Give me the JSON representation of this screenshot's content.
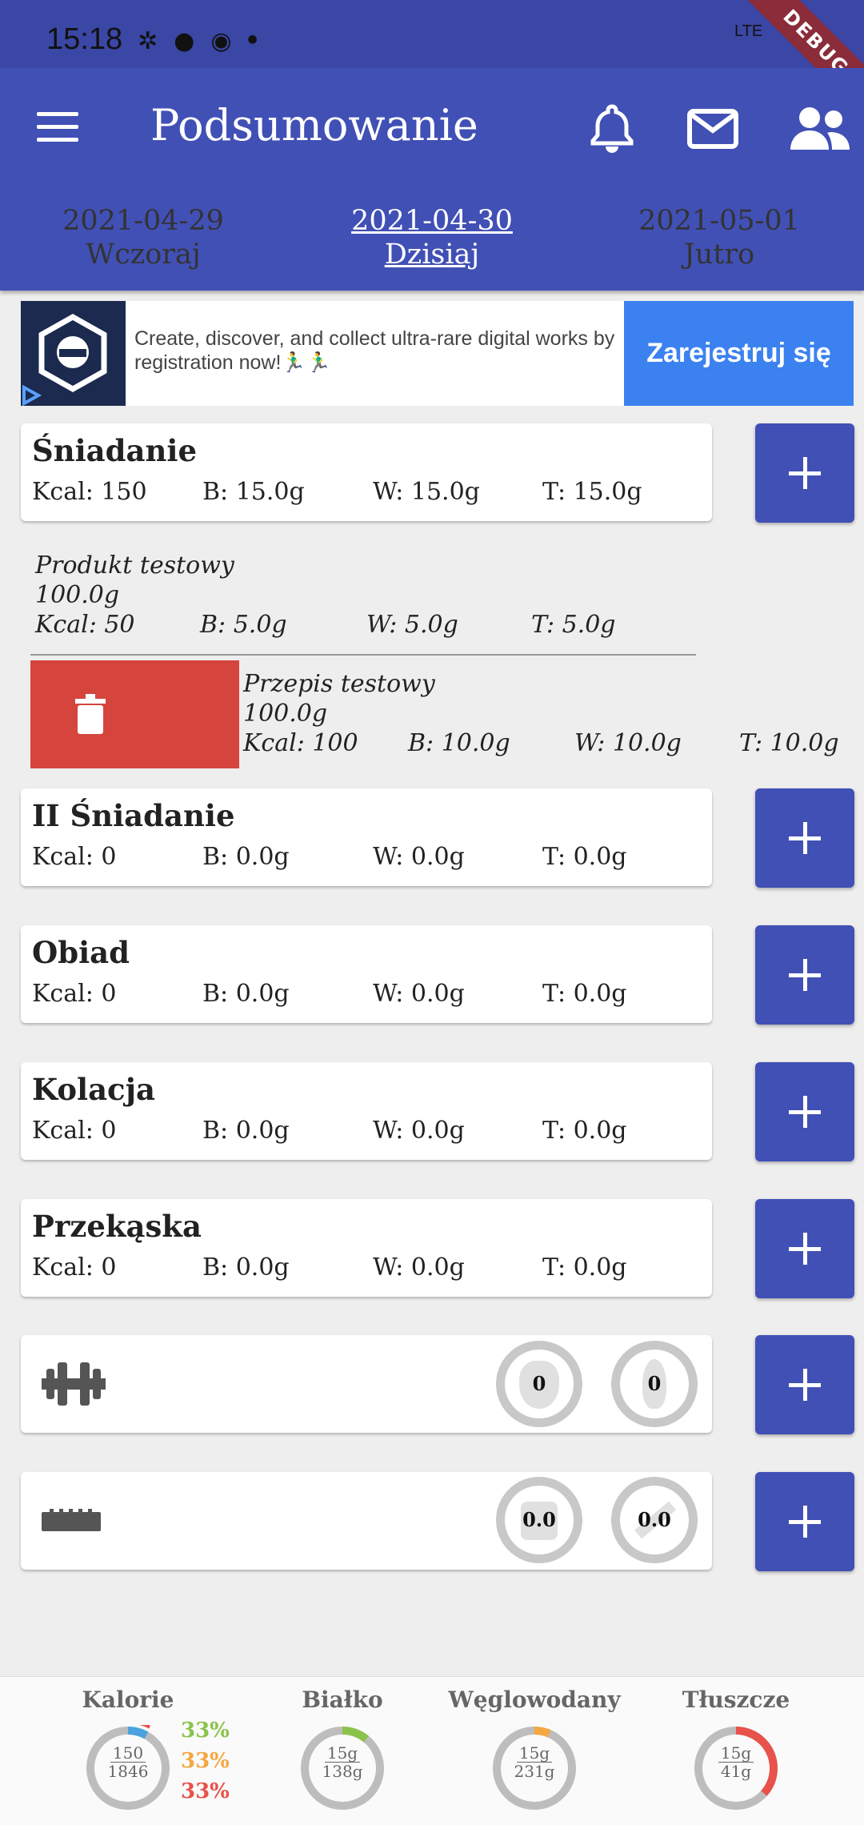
{
  "status": {
    "time": "15:18",
    "network": "LTE",
    "debug": "DEBUG"
  },
  "appbar": {
    "title": "Podsumowanie"
  },
  "dates": [
    {
      "date": "2021-04-29",
      "label": "Wczoraj"
    },
    {
      "date": "2021-04-30",
      "label": "Dzisiaj"
    },
    {
      "date": "2021-05-01",
      "label": "Jutro"
    }
  ],
  "ad": {
    "text": "Create, discover, and collect ultra-rare digital works by registration now!🏃‍♂️🏃‍♂️",
    "cta": "Zarejestruj się"
  },
  "meals": [
    {
      "name": "Śniadanie",
      "kcal": "Kcal: 150",
      "b": "B: 15.0g",
      "w": "W: 15.0g",
      "t": "T: 15.0g"
    },
    {
      "name": "II Śniadanie",
      "kcal": "Kcal: 0",
      "b": "B: 0.0g",
      "w": "W: 0.0g",
      "t": "T: 0.0g"
    },
    {
      "name": "Obiad",
      "kcal": "Kcal: 0",
      "b": "B: 0.0g",
      "w": "W: 0.0g",
      "t": "T: 0.0g"
    },
    {
      "name": "Kolacja",
      "kcal": "Kcal: 0",
      "b": "B: 0.0g",
      "w": "W: 0.0g",
      "t": "T: 0.0g"
    },
    {
      "name": "Przekąska",
      "kcal": "Kcal: 0",
      "b": "B: 0.0g",
      "w": "W: 0.0g",
      "t": "T: 0.0g"
    }
  ],
  "entries": [
    {
      "name": "Produkt testowy",
      "amount": "100.0g",
      "kcal": "Kcal: 50",
      "b": "B: 5.0g",
      "w": "W: 5.0g",
      "t": "T: 5.0g"
    },
    {
      "name": "Przepis testowy",
      "amount": "100.0g",
      "kcal": "Kcal: 100",
      "b": "B: 10.0g",
      "w": "W: 10.0g",
      "t": "T: 10.0g"
    }
  ],
  "activity": {
    "steps": "0",
    "burned": "0",
    "icon": "dumbbell-icon"
  },
  "measure": {
    "weight": "0.0",
    "other": "0.0",
    "icon": "ruler-icon"
  },
  "summary": {
    "kalorie": {
      "label": "Kalorie",
      "value": "150",
      "goal": "1846",
      "fraction": 0.081
    },
    "bialko": {
      "label": "Białko",
      "value": "15g",
      "goal": "138g",
      "fraction": 0.109,
      "color": "#8bc34a"
    },
    "weglowodany": {
      "label": "Węglowodany",
      "value": "15g",
      "goal": "231g",
      "fraction": 0.065,
      "color": "#f5a742"
    },
    "tluszcze": {
      "label": "Tłuszcze",
      "value": "15g",
      "goal": "41g",
      "fraction": 0.366,
      "color": "#e8524a"
    },
    "pcts": [
      {
        "value": "33%",
        "color": "#8bc34a"
      },
      {
        "value": "33%",
        "color": "#f5a742"
      },
      {
        "value": "33%",
        "color": "#e8524a"
      }
    ]
  }
}
